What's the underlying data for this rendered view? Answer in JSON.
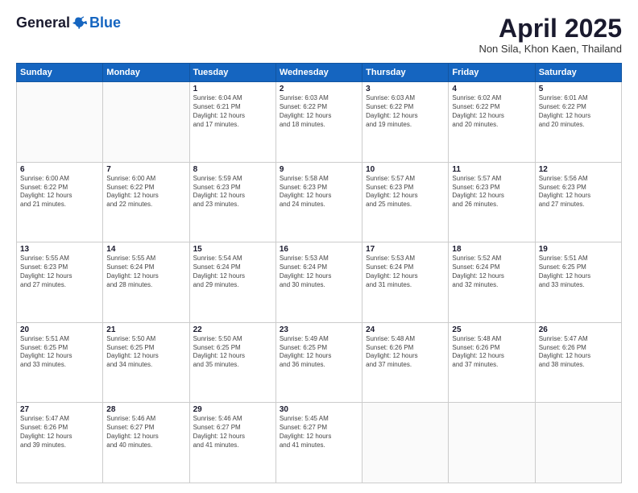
{
  "logo": {
    "general": "General",
    "blue": "Blue"
  },
  "header": {
    "title": "April 2025",
    "subtitle": "Non Sila, Khon Kaen, Thailand"
  },
  "weekdays": [
    "Sunday",
    "Monday",
    "Tuesday",
    "Wednesday",
    "Thursday",
    "Friday",
    "Saturday"
  ],
  "weeks": [
    [
      {
        "day": "",
        "info": ""
      },
      {
        "day": "",
        "info": ""
      },
      {
        "day": "1",
        "info": "Sunrise: 6:04 AM\nSunset: 6:21 PM\nDaylight: 12 hours\nand 17 minutes."
      },
      {
        "day": "2",
        "info": "Sunrise: 6:03 AM\nSunset: 6:22 PM\nDaylight: 12 hours\nand 18 minutes."
      },
      {
        "day": "3",
        "info": "Sunrise: 6:03 AM\nSunset: 6:22 PM\nDaylight: 12 hours\nand 19 minutes."
      },
      {
        "day": "4",
        "info": "Sunrise: 6:02 AM\nSunset: 6:22 PM\nDaylight: 12 hours\nand 20 minutes."
      },
      {
        "day": "5",
        "info": "Sunrise: 6:01 AM\nSunset: 6:22 PM\nDaylight: 12 hours\nand 20 minutes."
      }
    ],
    [
      {
        "day": "6",
        "info": "Sunrise: 6:00 AM\nSunset: 6:22 PM\nDaylight: 12 hours\nand 21 minutes."
      },
      {
        "day": "7",
        "info": "Sunrise: 6:00 AM\nSunset: 6:22 PM\nDaylight: 12 hours\nand 22 minutes."
      },
      {
        "day": "8",
        "info": "Sunrise: 5:59 AM\nSunset: 6:23 PM\nDaylight: 12 hours\nand 23 minutes."
      },
      {
        "day": "9",
        "info": "Sunrise: 5:58 AM\nSunset: 6:23 PM\nDaylight: 12 hours\nand 24 minutes."
      },
      {
        "day": "10",
        "info": "Sunrise: 5:57 AM\nSunset: 6:23 PM\nDaylight: 12 hours\nand 25 minutes."
      },
      {
        "day": "11",
        "info": "Sunrise: 5:57 AM\nSunset: 6:23 PM\nDaylight: 12 hours\nand 26 minutes."
      },
      {
        "day": "12",
        "info": "Sunrise: 5:56 AM\nSunset: 6:23 PM\nDaylight: 12 hours\nand 27 minutes."
      }
    ],
    [
      {
        "day": "13",
        "info": "Sunrise: 5:55 AM\nSunset: 6:23 PM\nDaylight: 12 hours\nand 27 minutes."
      },
      {
        "day": "14",
        "info": "Sunrise: 5:55 AM\nSunset: 6:24 PM\nDaylight: 12 hours\nand 28 minutes."
      },
      {
        "day": "15",
        "info": "Sunrise: 5:54 AM\nSunset: 6:24 PM\nDaylight: 12 hours\nand 29 minutes."
      },
      {
        "day": "16",
        "info": "Sunrise: 5:53 AM\nSunset: 6:24 PM\nDaylight: 12 hours\nand 30 minutes."
      },
      {
        "day": "17",
        "info": "Sunrise: 5:53 AM\nSunset: 6:24 PM\nDaylight: 12 hours\nand 31 minutes."
      },
      {
        "day": "18",
        "info": "Sunrise: 5:52 AM\nSunset: 6:24 PM\nDaylight: 12 hours\nand 32 minutes."
      },
      {
        "day": "19",
        "info": "Sunrise: 5:51 AM\nSunset: 6:25 PM\nDaylight: 12 hours\nand 33 minutes."
      }
    ],
    [
      {
        "day": "20",
        "info": "Sunrise: 5:51 AM\nSunset: 6:25 PM\nDaylight: 12 hours\nand 33 minutes."
      },
      {
        "day": "21",
        "info": "Sunrise: 5:50 AM\nSunset: 6:25 PM\nDaylight: 12 hours\nand 34 minutes."
      },
      {
        "day": "22",
        "info": "Sunrise: 5:50 AM\nSunset: 6:25 PM\nDaylight: 12 hours\nand 35 minutes."
      },
      {
        "day": "23",
        "info": "Sunrise: 5:49 AM\nSunset: 6:25 PM\nDaylight: 12 hours\nand 36 minutes."
      },
      {
        "day": "24",
        "info": "Sunrise: 5:48 AM\nSunset: 6:26 PM\nDaylight: 12 hours\nand 37 minutes."
      },
      {
        "day": "25",
        "info": "Sunrise: 5:48 AM\nSunset: 6:26 PM\nDaylight: 12 hours\nand 37 minutes."
      },
      {
        "day": "26",
        "info": "Sunrise: 5:47 AM\nSunset: 6:26 PM\nDaylight: 12 hours\nand 38 minutes."
      }
    ],
    [
      {
        "day": "27",
        "info": "Sunrise: 5:47 AM\nSunset: 6:26 PM\nDaylight: 12 hours\nand 39 minutes."
      },
      {
        "day": "28",
        "info": "Sunrise: 5:46 AM\nSunset: 6:27 PM\nDaylight: 12 hours\nand 40 minutes."
      },
      {
        "day": "29",
        "info": "Sunrise: 5:46 AM\nSunset: 6:27 PM\nDaylight: 12 hours\nand 41 minutes."
      },
      {
        "day": "30",
        "info": "Sunrise: 5:45 AM\nSunset: 6:27 PM\nDaylight: 12 hours\nand 41 minutes."
      },
      {
        "day": "",
        "info": ""
      },
      {
        "day": "",
        "info": ""
      },
      {
        "day": "",
        "info": ""
      }
    ]
  ]
}
